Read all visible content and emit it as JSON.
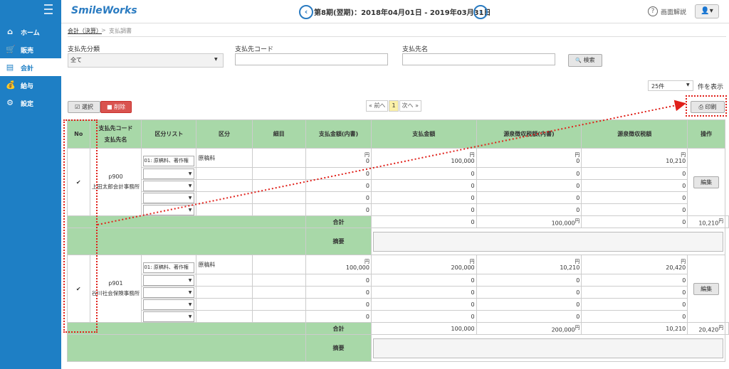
{
  "app": {
    "brand": "SmileWorks"
  },
  "header": {
    "prev_icon": "‹",
    "period": "第8期(翌期)：2018年04月01日 - 2019年03月31日",
    "next_icon": "›",
    "help_icon": "?",
    "help_label": "画面解説",
    "user_icon": "👤▾"
  },
  "sidebar": {
    "items": [
      {
        "label": "ホーム",
        "icon": "⌂"
      },
      {
        "label": "販売",
        "icon": "🛒"
      },
      {
        "label": "会計",
        "icon": "▤"
      },
      {
        "label": "給与",
        "icon": "💰"
      },
      {
        "label": "設定",
        "icon": "⚙"
      }
    ],
    "active_index": 2
  },
  "breadcrumb": {
    "parent": "会計（決算）",
    "sep": ">",
    "current": "支払調書"
  },
  "search": {
    "type_label": "支払先分類",
    "type_value": "全て",
    "code_label": "支払先コード",
    "name_label": "支払先名",
    "search_button": "検索",
    "search_icon": "🔍"
  },
  "paging": {
    "size": "25件",
    "size_suffix": "件を表示",
    "prev": "« 前へ",
    "page": "1",
    "next": "次へ »"
  },
  "actions": {
    "select": "選択",
    "delete": "削除",
    "print": "印刷"
  },
  "table": {
    "headers": {
      "no": "No",
      "code": "支払先コード",
      "name": "支払先名",
      "category_list": "区分リスト",
      "category": "区分",
      "detail": "細目",
      "amount_internal": "支払金額(内書)",
      "amount": "支払金額",
      "withholding_internal": "源泉徴収税額(内書)",
      "withholding": "源泉徴収税額",
      "ops": "操作"
    },
    "yen": "円",
    "total_label": "合計",
    "memo_label": "摘要",
    "edit_label": "編集",
    "groups": [
      {
        "code": "p900",
        "name": "上田太郎会計事務所",
        "checked": true,
        "rows": [
          {
            "cat_list": "01: 原稿料、著作権",
            "category": "原稿料",
            "amount_internal": "0",
            "amount": "100,000",
            "withholding_internal": "0",
            "withholding": "10,210"
          },
          {
            "cat_list": "",
            "category": "",
            "amount_internal": "0",
            "amount": "0",
            "withholding_internal": "0",
            "withholding": "0"
          },
          {
            "cat_list": "",
            "category": "",
            "amount_internal": "0",
            "amount": "0",
            "withholding_internal": "0",
            "withholding": "0"
          },
          {
            "cat_list": "",
            "category": "",
            "amount_internal": "0",
            "amount": "0",
            "withholding_internal": "0",
            "withholding": "0"
          },
          {
            "cat_list": "",
            "category": "",
            "amount_internal": "0",
            "amount": "0",
            "withholding_internal": "0",
            "withholding": "0"
          }
        ],
        "total": {
          "amount_internal": "0",
          "amount": "100,000",
          "withholding_internal": "0",
          "withholding": "10,210"
        }
      },
      {
        "code": "p901",
        "name": "谷川社会保険事務所",
        "checked": true,
        "rows": [
          {
            "cat_list": "01: 原稿料、著作権",
            "category": "原稿料",
            "amount_internal": "100,000",
            "amount": "200,000",
            "withholding_internal": "10,210",
            "withholding": "20,420"
          },
          {
            "cat_list": "",
            "category": "",
            "amount_internal": "0",
            "amount": "0",
            "withholding_internal": "0",
            "withholding": "0"
          },
          {
            "cat_list": "",
            "category": "",
            "amount_internal": "0",
            "amount": "0",
            "withholding_internal": "0",
            "withholding": "0"
          },
          {
            "cat_list": "",
            "category": "",
            "amount_internal": "0",
            "amount": "0",
            "withholding_internal": "0",
            "withholding": "0"
          },
          {
            "cat_list": "",
            "category": "",
            "amount_internal": "0",
            "amount": "0",
            "withholding_internal": "0",
            "withholding": "0"
          }
        ],
        "total": {
          "amount_internal": "100,000",
          "amount": "200,000",
          "withholding_internal": "10,210",
          "withholding": "20,420"
        }
      }
    ]
  },
  "colors": {
    "sidebar": "#1e7fc5",
    "header_green": "#a8d8a8",
    "highlight_red": "#e0201a",
    "delete_red": "#d9534f"
  }
}
